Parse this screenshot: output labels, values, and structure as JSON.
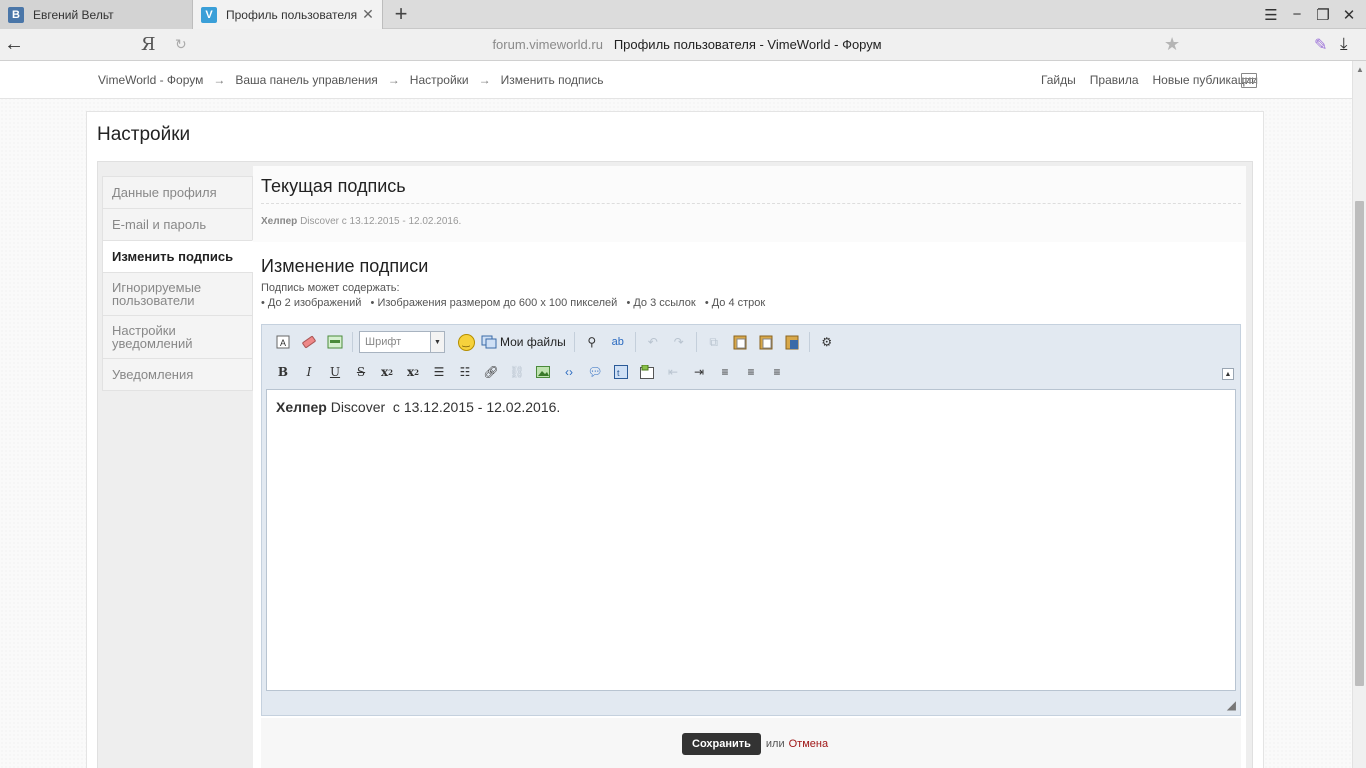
{
  "browser": {
    "tabs": [
      {
        "title": "Евгений Вельт",
        "favicon": "В"
      },
      {
        "title": "Профиль пользователя - ",
        "favicon": "V"
      }
    ],
    "search_logo": "Я",
    "url_domain": "forum.vimeworld.ru",
    "url_title": "Профиль пользователя - VimeWorld - Форум"
  },
  "nav": {
    "breadcrumbs": [
      "VimeWorld - Форум",
      "Ваша панель управления",
      "Настройки",
      "Изменить подпись"
    ],
    "arrow": "→",
    "links": [
      "Гайды",
      "Правила",
      "Новые публикации"
    ]
  },
  "page": {
    "title": "Настройки"
  },
  "sidebar": {
    "items": [
      {
        "label": "Данные профиля",
        "active": false
      },
      {
        "label": "E-mail и пароль",
        "active": false
      },
      {
        "label": "Изменить подпись",
        "active": true
      },
      {
        "label": "Игнорируемые пользователи",
        "active": false
      },
      {
        "label": "Настройки уведомлений",
        "active": false
      },
      {
        "label": "Уведомления",
        "active": false
      }
    ]
  },
  "current_signature": {
    "heading": "Текущая подпись",
    "bold": "Хелпер",
    "rest": " Discover  с 13.12.2015 - 12.02.2016."
  },
  "edit_signature": {
    "heading": "Изменение подписи",
    "may_contain": "Подпись может содержать:",
    "limits": "• До 2 изображений   • Изображения размером до 600 x 100 пикселей   • До 3 ссылок   • До 4 строк"
  },
  "editor": {
    "font_placeholder": "Шрифт",
    "my_files": "Мои файлы",
    "content_bold": "Хелпер",
    "content_rest": " Discover  с 13.12.2015 - 12.02.2016."
  },
  "actions": {
    "save": "Сохранить",
    "or": "или",
    "cancel": "Отмена"
  },
  "colors": {
    "accent_cancel": "#a01818",
    "editor_bg": "#e2e9f1"
  }
}
